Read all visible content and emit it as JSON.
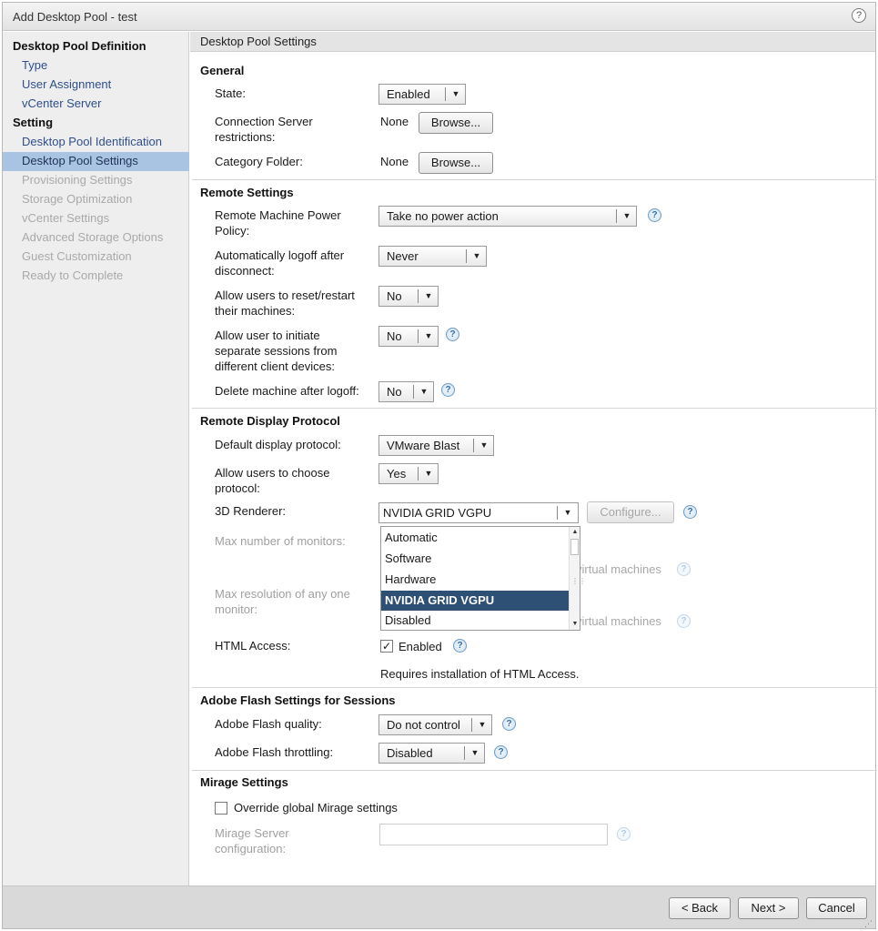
{
  "window": {
    "title": "Add Desktop Pool - test",
    "help_glyph": "?"
  },
  "sidebar": {
    "items": [
      {
        "label": "Desktop Pool Definition",
        "state": "header"
      },
      {
        "label": "Type",
        "state": "link"
      },
      {
        "label": "User Assignment",
        "state": "link"
      },
      {
        "label": "vCenter Server",
        "state": "link"
      },
      {
        "label": "Setting",
        "state": "header"
      },
      {
        "label": "Desktop Pool Identification",
        "state": "link"
      },
      {
        "label": "Desktop Pool Settings",
        "state": "active"
      },
      {
        "label": "Provisioning Settings",
        "state": "disabled"
      },
      {
        "label": "Storage Optimization",
        "state": "disabled"
      },
      {
        "label": "vCenter Settings",
        "state": "disabled"
      },
      {
        "label": "Advanced Storage Options",
        "state": "disabled"
      },
      {
        "label": "Guest Customization",
        "state": "disabled"
      },
      {
        "label": "Ready to Complete",
        "state": "disabled"
      }
    ]
  },
  "content": {
    "header": "Desktop Pool Settings",
    "general": {
      "title": "General",
      "state_label": "State:",
      "state_value": "Enabled",
      "conn_label": "Connection Server restrictions:",
      "conn_value": "None",
      "category_label": "Category Folder:",
      "category_value": "None",
      "browse_label": "Browse..."
    },
    "remote": {
      "title": "Remote Settings",
      "power_label": "Remote Machine Power Policy:",
      "power_value": "Take no power action",
      "logoff_label": "Automatically logoff after disconnect:",
      "logoff_value": "Never",
      "reset_label": "Allow users to reset/restart their machines:",
      "reset_value": "No",
      "sessions_label": "Allow user to initiate separate sessions from different client devices:",
      "sessions_value": "No",
      "delete_label": "Delete machine after logoff:",
      "delete_value": "No"
    },
    "display": {
      "title": "Remote Display Protocol",
      "protocol_label": "Default display protocol:",
      "protocol_value": "VMware Blast",
      "choose_label": "Allow users to choose protocol:",
      "choose_value": "Yes",
      "renderer_label": "3D Renderer:",
      "renderer_value": "NVIDIA GRID VGPU",
      "configure_label": "Configure...",
      "monitors_label": "Max number of monitors:",
      "resolution_label": "Max resolution of any one monitor:",
      "vm_note_partial": "virtual machines",
      "renderer_options": [
        "Automatic",
        "Software",
        "Hardware",
        "NVIDIA GRID VGPU",
        "Disabled"
      ],
      "renderer_selected_index": 3,
      "html_label": "HTML Access:",
      "html_checked": true,
      "html_value": "Enabled",
      "html_note": "Requires installation of HTML Access."
    },
    "flash": {
      "title": "Adobe Flash Settings for Sessions",
      "quality_label": "Adobe Flash quality:",
      "quality_value": "Do not control",
      "throttle_label": "Adobe Flash throttling:",
      "throttle_value": "Disabled"
    },
    "mirage": {
      "title": "Mirage Settings",
      "override_checked": false,
      "override_label": "Override global Mirage settings",
      "server_label": "Mirage Server configuration:",
      "server_value": ""
    }
  },
  "footer": {
    "back_label": "< Back",
    "next_label": "Next >",
    "cancel_label": "Cancel"
  },
  "glyphs": {
    "dropdown_arrow": "▼",
    "scroll_up": "▲",
    "scroll_down": "▼",
    "check": "✓",
    "help": "?"
  }
}
